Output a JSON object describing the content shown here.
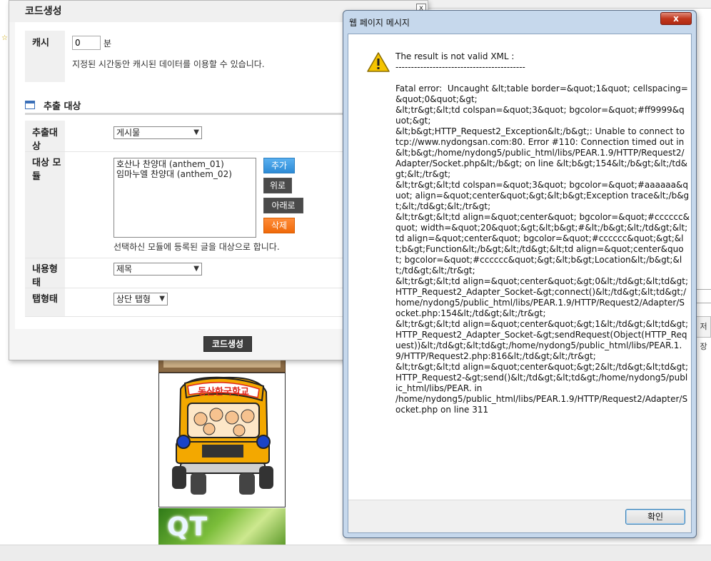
{
  "background": {
    "tabs": [
      "",
      "",
      ""
    ],
    "right_button": "저장",
    "right_text": "",
    "qt_text": "QT",
    "bus_label": "동산한국학교"
  },
  "code_dialog": {
    "title": "코드생성",
    "close": "x",
    "cache": {
      "label": "캐시",
      "value": "0",
      "unit": "분",
      "help": "지정된 시간동안 캐시된 데이터를 이용할 수 있습니다."
    },
    "section": {
      "title": "추출 대상"
    },
    "target": {
      "label": "추출대상",
      "selected": "게시물"
    },
    "module": {
      "label": "대상 모듈",
      "items": [
        "호산나 찬양대 (anthem_01)",
        "임마누엘 찬양대 (anthem_02)"
      ],
      "help": "선택하신 모듈에 등록된 글을 대상으로 합니다.",
      "add": "추가",
      "up": "위로",
      "down": "아래로",
      "delete": "삭제"
    },
    "content": {
      "label": "내용형태",
      "selected": "제목"
    },
    "tab": {
      "label": "탭형태",
      "selected": "상단 탭형"
    },
    "generate": "코드생성"
  },
  "message": {
    "title": "웹 페이지 메시지",
    "close": "x",
    "body": "The result is not valid XML :\n------------------------------------------\n\nFatal error:  Uncaught &lt;table border=&quot;1&quot; cellspacing=&quot;0&quot;&gt;\n&lt;tr&gt;&lt;td colspan=&quot;3&quot; bgcolor=&quot;#ff9999&quot;&gt;\n&lt;b&gt;HTTP_Request2_Exception&lt;/b&gt;: Unable to connect to tcp://www.nydongsan.com:80. Error #110: Connection timed out in &lt;b&gt;/home/nydong5/public_html/libs/PEAR.1.9/HTTP/Request2/Adapter/Socket.php&lt;/b&gt; on line &lt;b&gt;154&lt;/b&gt;&lt;/td&gt;&lt;/tr&gt;\n&lt;tr&gt;&lt;td colspan=&quot;3&quot; bgcolor=&quot;#aaaaaa&quot; align=&quot;center&quot;&gt;&lt;b&gt;Exception trace&lt;/b&gt;&lt;/td&gt;&lt;/tr&gt;\n&lt;tr&gt;&lt;td align=&quot;center&quot; bgcolor=&quot;#cccccc&quot; width=&quot;20&quot;&gt;&lt;b&gt;#&lt;/b&gt;&lt;/td&gt;&lt;td align=&quot;center&quot; bgcolor=&quot;#cccccc&quot;&gt;&lt;b&gt;Function&lt;/b&gt;&lt;/td&gt;&lt;td align=&quot;center&quot; bgcolor=&quot;#cccccc&quot;&gt;&lt;b&gt;Location&lt;/b&gt;&lt;/td&gt;&lt;/tr&gt;\n&lt;tr&gt;&lt;td align=&quot;center&quot;&gt;0&lt;/td&gt;&lt;td&gt;HTTP_Request2_Adapter_Socket-&gt;connect()&lt;/td&gt;&lt;td&gt;/home/nydong5/public_html/libs/PEAR.1.9/HTTP/Request2/Adapter/Socket.php:154&lt;/td&gt;&lt;/tr&gt;\n&lt;tr&gt;&lt;td align=&quot;center&quot;&gt;1&lt;/td&gt;&lt;td&gt;HTTP_Request2_Adapter_Socket-&gt;sendRequest(Object(HTTP_Request))&lt;/td&gt;&lt;td&gt;/home/nydong5/public_html/libs/PEAR.1.9/HTTP/Request2.php:816&lt;/td&gt;&lt;/tr&gt;\n&lt;tr&gt;&lt;td align=&quot;center&quot;&gt;2&lt;/td&gt;&lt;td&gt;HTTP_Request2-&gt;send()&lt;/td&gt;&lt;td&gt;/home/nydong5/public_html/libs/PEAR. in\n/home/nydong5/public_html/libs/PEAR.1.9/HTTP/Request2/Adapter/Socket.php on line 311",
    "ok": "확인"
  }
}
